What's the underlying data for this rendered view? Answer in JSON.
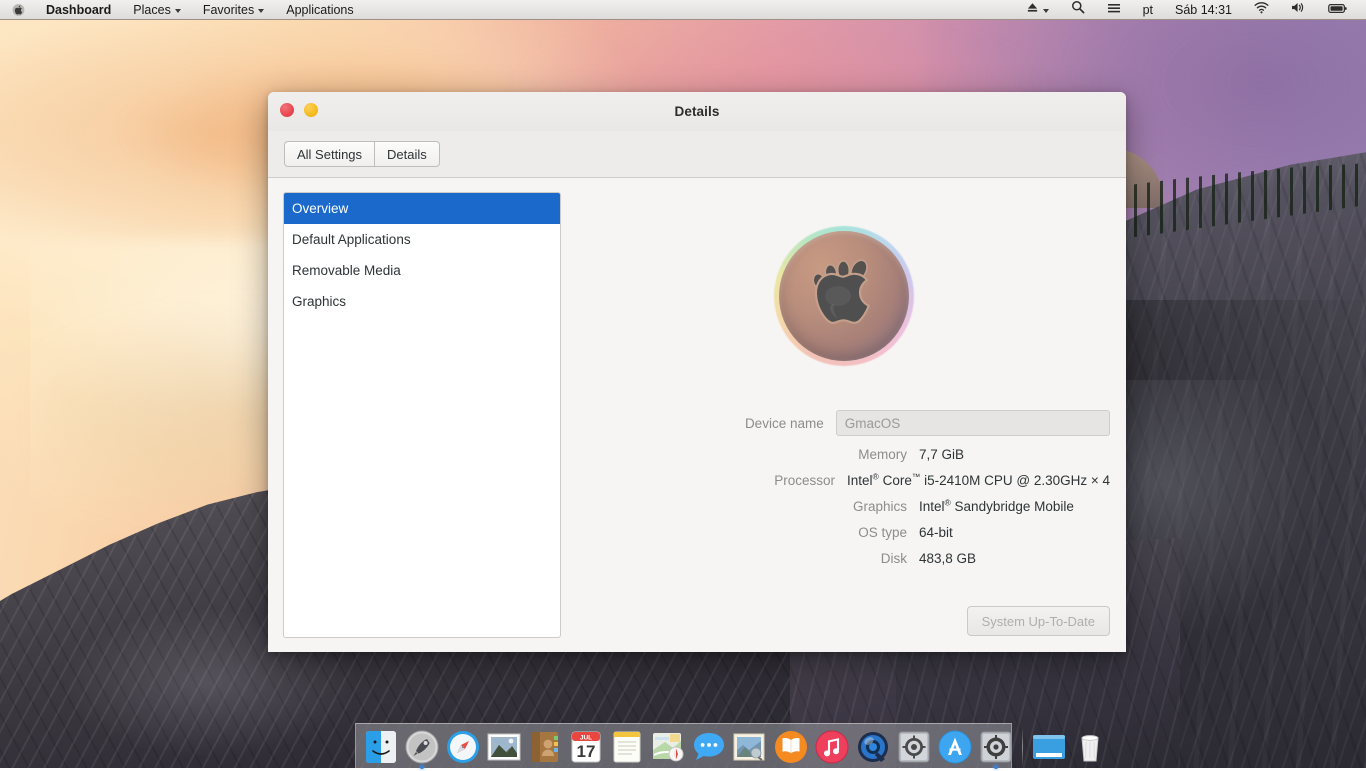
{
  "menubar": {
    "apple_icon": "apple-logo-icon",
    "items": [
      {
        "label": "Dashboard",
        "has_caret": false,
        "bold": true
      },
      {
        "label": "Places",
        "has_caret": true,
        "bold": false
      },
      {
        "label": "Favorites",
        "has_caret": true,
        "bold": false
      },
      {
        "label": "Applications",
        "has_caret": false,
        "bold": false
      }
    ],
    "status": {
      "eject_icon": "eject-icon",
      "eject_caret": "chevron-down-icon",
      "search_icon": "search-icon",
      "menu_icon": "hamburger-menu-icon",
      "keyboard_layout": "pt",
      "clock": "Sáb 14:31",
      "wifi_icon": "wifi-icon",
      "volume_icon": "volume-icon",
      "battery_icon": "battery-icon"
    }
  },
  "window": {
    "title": "Details",
    "controls": {
      "close": "close-button",
      "minimize": "minimize-button"
    },
    "toolbar": {
      "all_settings_label": "All Settings",
      "details_label": "Details"
    }
  },
  "sidebar": {
    "items": [
      {
        "label": "Overview",
        "selected": true
      },
      {
        "label": "Default Applications",
        "selected": false
      },
      {
        "label": "Removable Media",
        "selected": false
      },
      {
        "label": "Graphics",
        "selected": false
      }
    ]
  },
  "overview": {
    "logo_icon": "gmacos-apple-gnome-logo",
    "rows": [
      {
        "label": "Device name",
        "value": "GmacOS",
        "type": "input"
      },
      {
        "label": "Memory",
        "value": "7,7 GiB",
        "type": "text"
      },
      {
        "label": "Processor",
        "value": "Intel® Core™ i5-2410M CPU @ 2.30GHz × 4",
        "type": "rich"
      },
      {
        "label": "Graphics",
        "value": "Intel® Sandybridge Mobile",
        "type": "rich"
      },
      {
        "label": "OS type",
        "value": "64-bit",
        "type": "text"
      },
      {
        "label": "Disk",
        "value": "483,8 GB",
        "type": "text"
      }
    ],
    "update_button": "System Up-To-Date"
  },
  "dock": {
    "items": [
      {
        "name": "finder",
        "running": false
      },
      {
        "name": "launchpad",
        "running": true
      },
      {
        "name": "safari",
        "running": false
      },
      {
        "name": "mail",
        "running": false
      },
      {
        "name": "contacts",
        "running": false
      },
      {
        "name": "calendar",
        "running": false
      },
      {
        "name": "notes",
        "running": false
      },
      {
        "name": "maps",
        "running": false
      },
      {
        "name": "messages",
        "running": false
      },
      {
        "name": "photos",
        "running": false
      },
      {
        "name": "ibooks",
        "running": false
      },
      {
        "name": "itunes",
        "running": false
      },
      {
        "name": "quicktime",
        "running": false
      },
      {
        "name": "system-preferences",
        "running": false
      },
      {
        "name": "app-store",
        "running": false
      },
      {
        "name": "settings",
        "running": true
      },
      {
        "name": "downloads-stack",
        "running": false
      },
      {
        "name": "trash",
        "running": false
      }
    ],
    "calendar_month": "JUL",
    "calendar_day": "17"
  },
  "colors": {
    "accent": "#1b6acb",
    "window_bg": "#f6f5f4",
    "close_button": "#e8484f",
    "minimize_button": "#f6bb1e",
    "label_text": "#8c8c8c",
    "value_text": "#2e3436"
  }
}
